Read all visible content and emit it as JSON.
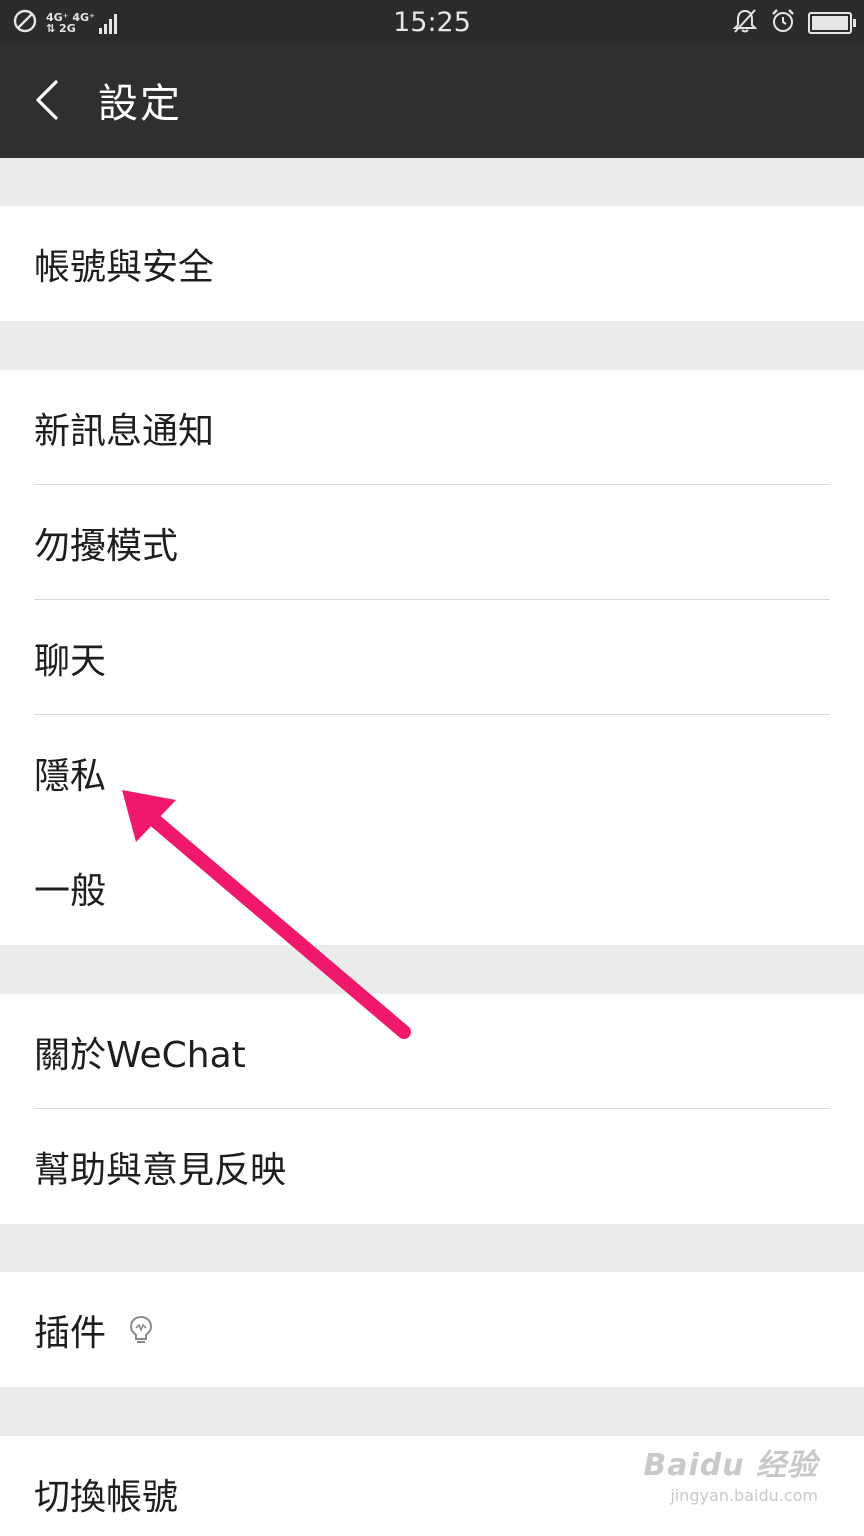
{
  "status_bar": {
    "time": "15:25",
    "network_top": "4G⁺ 4G⁺",
    "network_bottom": "⇅ 2G",
    "icons": [
      "no-sim-icon",
      "signal-icon",
      "mute-icon",
      "alarm-icon",
      "battery-icon"
    ]
  },
  "header": {
    "title": "設定",
    "back_icon": "chevron-left-icon"
  },
  "groups": [
    {
      "items": [
        {
          "label": "帳號與安全"
        }
      ]
    },
    {
      "items": [
        {
          "label": "新訊息通知"
        },
        {
          "label": "勿擾模式"
        },
        {
          "label": "聊天"
        },
        {
          "label": "隱私"
        },
        {
          "label": "一般"
        }
      ]
    },
    {
      "items": [
        {
          "label": "關於WeChat"
        },
        {
          "label": "幫助與意見反映"
        }
      ]
    },
    {
      "items": [
        {
          "label": "插件",
          "badge_icon": "bulb-icon"
        }
      ]
    },
    {
      "items": [
        {
          "label": "切換帳號"
        }
      ]
    }
  ],
  "annotation": {
    "arrow_color": "#f0186a",
    "points_to": "隱私"
  },
  "watermark": {
    "main": "Baidu 经验",
    "sub": "jingyan.baidu.com"
  },
  "colors": {
    "status_bg": "#2b2b2b",
    "header_bg": "#2f2f2f",
    "page_bg": "#ebebeb",
    "row_bg": "#ffffff",
    "arrow": "#f0186a"
  }
}
